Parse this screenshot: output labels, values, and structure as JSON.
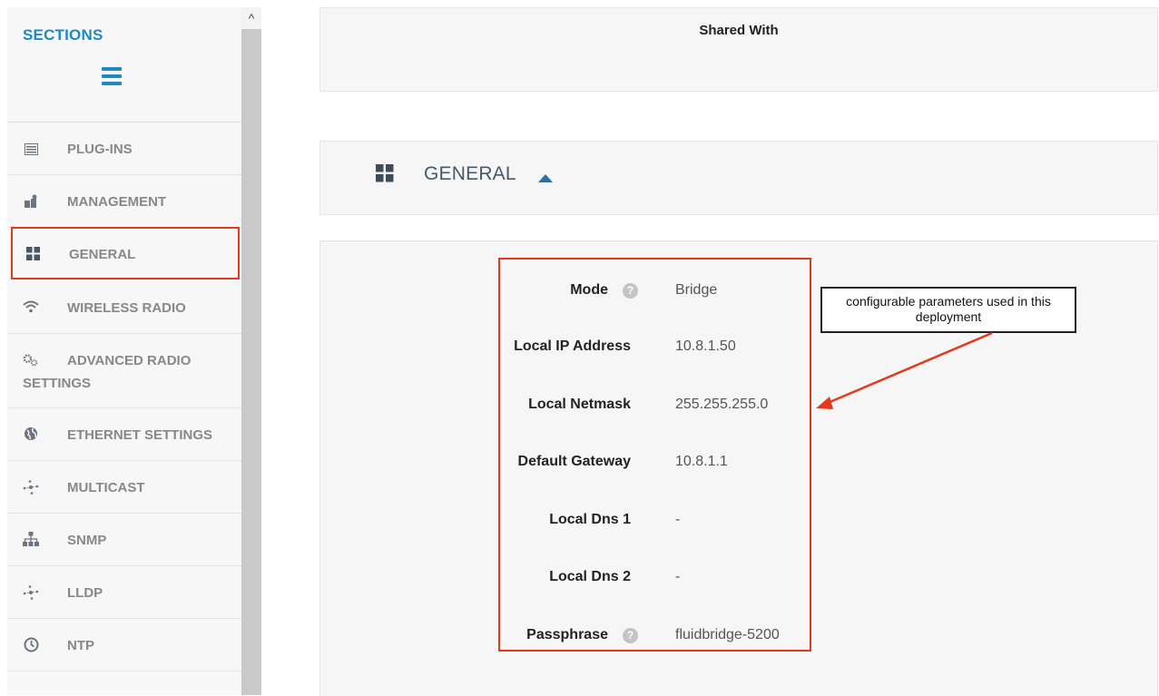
{
  "sidebar": {
    "title": "SECTIONS",
    "scroll_up_glyph": "^",
    "items": [
      {
        "label": "PLUG-INS",
        "icon": "list-icon"
      },
      {
        "label": "MANAGEMENT",
        "icon": "management-icon"
      },
      {
        "label": "GENERAL",
        "icon": "grid-icon",
        "selected": true
      },
      {
        "label": "WIRELESS RADIO",
        "icon": "wifi-icon"
      },
      {
        "label_line1": "ADVANCED RADIO",
        "label_line2": "SETTINGS",
        "icon": "gears-icon"
      },
      {
        "label": "ETHERNET SETTINGS",
        "icon": "globe-icon"
      },
      {
        "label": "MULTICAST",
        "icon": "multicast-icon"
      },
      {
        "label": "SNMP",
        "icon": "sitemap-icon"
      },
      {
        "label": "LLDP",
        "icon": "lldp-icon"
      },
      {
        "label": "NTP",
        "icon": "clock-icon"
      }
    ]
  },
  "main": {
    "shared_with": "Shared With",
    "general_title": "GENERAL",
    "params": [
      {
        "label": "Mode",
        "value": "Bridge",
        "help": true
      },
      {
        "label": "Local IP Address",
        "value": "10.8.1.50"
      },
      {
        "label": "Local Netmask",
        "value": "255.255.255.0"
      },
      {
        "label": "Default Gateway",
        "value": "10.8.1.1"
      },
      {
        "label": "Local Dns 1",
        "value": "-"
      },
      {
        "label": "Local Dns 2",
        "value": "-"
      },
      {
        "label": "Passphrase",
        "value": "fluidbridge-5200",
        "help": true
      }
    ],
    "help_glyph": "?"
  },
  "annotation": {
    "line1": "configurable parameters used in this",
    "line2": "deployment"
  },
  "colors": {
    "accent": "#1f8ac0",
    "highlight_red": "#e23a1d",
    "arrow_blue": "#2d6fa5"
  }
}
